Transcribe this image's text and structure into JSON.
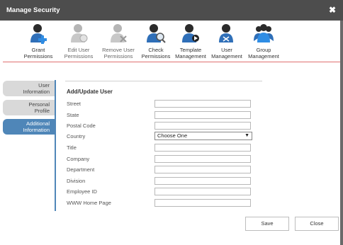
{
  "window": {
    "title": "Manage Security",
    "close_glyph": "✖"
  },
  "toolbar": {
    "items": [
      {
        "label1": "Grant",
        "label2": "Permissions",
        "icon": "grant-permissions-icon",
        "accent": "#2f8de4",
        "enabled": true
      },
      {
        "label1": "Edit User",
        "label2": "Permissions",
        "icon": "edit-user-permissions-icon",
        "accent": "#aaaaaa",
        "enabled": false
      },
      {
        "label1": "Remove User",
        "label2": "Permissions",
        "icon": "remove-user-permissions-icon",
        "accent": "#aaaaaa",
        "enabled": false
      },
      {
        "label1": "Check",
        "label2": "Permissions",
        "icon": "check-permissions-icon",
        "accent": "#2f8de4",
        "enabled": true
      },
      {
        "label1": "Template",
        "label2": "Management",
        "icon": "template-management-icon",
        "accent": "#2f8de4",
        "enabled": true
      },
      {
        "label1": "User",
        "label2": "Management",
        "icon": "user-management-icon",
        "accent": "#2f8de4",
        "enabled": true
      },
      {
        "label1": "Group",
        "label2": "Management",
        "icon": "group-management-icon",
        "accent": "#2f8de4",
        "enabled": true
      }
    ]
  },
  "sidebar": {
    "items": [
      {
        "line1": "User",
        "line2": "Information",
        "active": false
      },
      {
        "line1": "Personal",
        "line2": "Profile",
        "active": false
      },
      {
        "line1": "Additional",
        "line2": "Information",
        "active": true
      }
    ]
  },
  "form": {
    "title": "Add/Update User",
    "fields": {
      "street": {
        "label": "Street",
        "value": ""
      },
      "state": {
        "label": "State",
        "value": ""
      },
      "postal_code": {
        "label": "Postal Code",
        "value": ""
      },
      "country": {
        "label": "Country",
        "value": "Choose One"
      },
      "title": {
        "label": "Title",
        "value": ""
      },
      "company": {
        "label": "Company",
        "value": ""
      },
      "department": {
        "label": "Department",
        "value": ""
      },
      "division": {
        "label": "Division",
        "value": ""
      },
      "employee_id": {
        "label": "Employee ID",
        "value": ""
      },
      "www_home_page": {
        "label": "WWW Home Page",
        "value": ""
      }
    }
  },
  "buttons": {
    "save": "Save",
    "close": "Close"
  },
  "colors": {
    "titlebar": "#4d4d4d",
    "active_tab": "#4f86b8",
    "divider": "#e07070"
  }
}
